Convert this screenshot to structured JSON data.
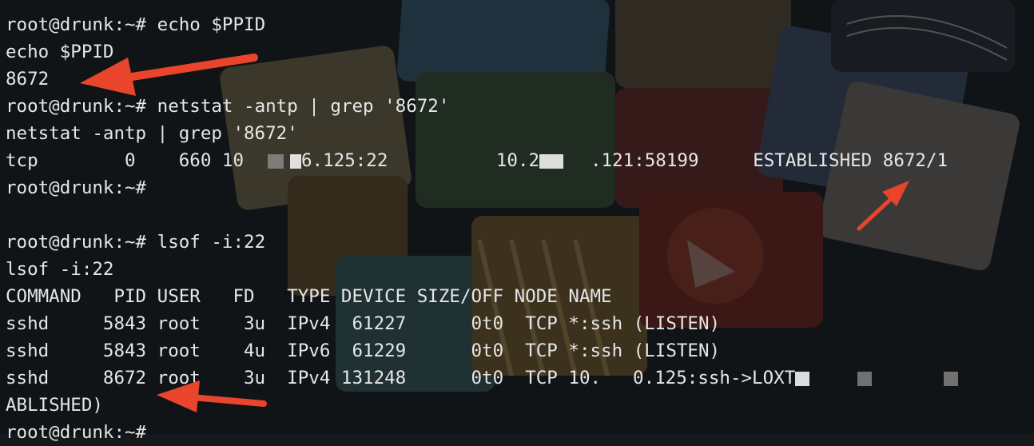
{
  "terminal": {
    "prompt": "root@drunk:~# ",
    "lines": {
      "l1_cmd": "echo $PPID",
      "l2": "echo $PPID",
      "l3": "8672",
      "l4_cmd": "netstat -antp | grep '8672'",
      "l5": "netstat -antp | grep '8672'",
      "l6_a": "tcp        0    660 10",
      "l6_b": "6.125:22          10.2",
      "l6_c": ".121:58199     ESTABLISHED 8672/1",
      "l7_prompt": "root@drunk:~#",
      "l9_cmd": "lsof -i:22",
      "l10": "lsof -i:22",
      "l11": "COMMAND   PID USER   FD   TYPE DEVICE SIZE/OFF NODE NAME",
      "l12": "sshd     5843 root    3u  IPv4  61227      0t0  TCP *:ssh (LISTEN)",
      "l13": "sshd     5843 root    4u  IPv6  61229      0t0  TCP *:ssh (LISTEN)",
      "l14_a": "sshd     8672 root    3u  IPv4 131248      0t0  TCP 10.",
      "l14_b": "0.125:ssh->LOXT",
      "l15": "ABLISHED)",
      "l16_prompt": "root@drunk:~#"
    }
  },
  "colors": {
    "text": "#e6e6e6",
    "arrow": "#e8452c",
    "background": "#16181c"
  }
}
